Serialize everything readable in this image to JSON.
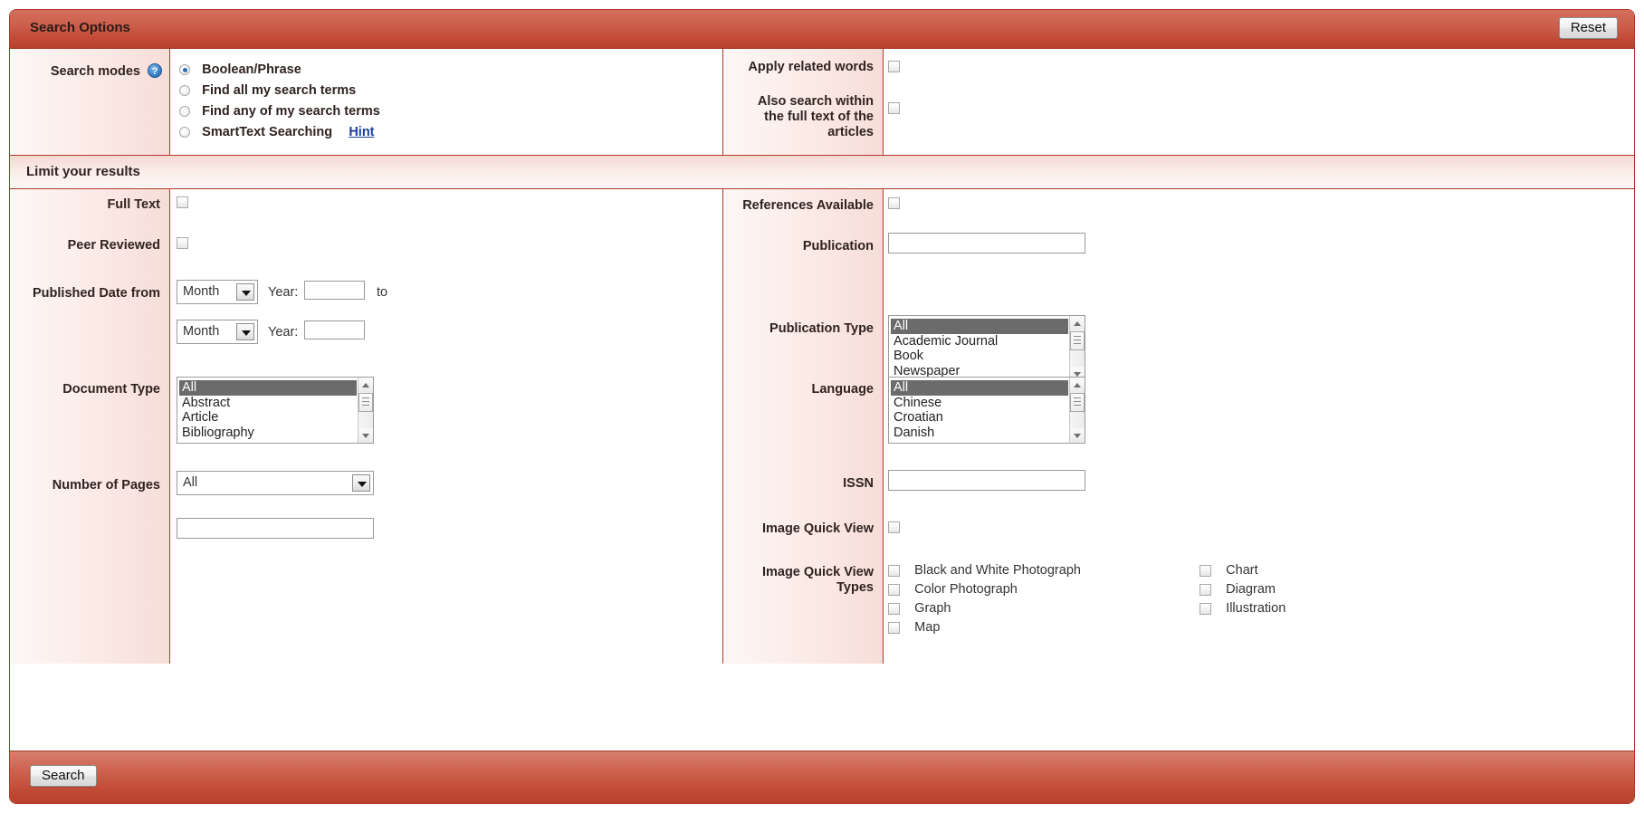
{
  "search_options": {
    "header_title": "Search Options",
    "reset_label": "Reset",
    "search_modes": {
      "label": "Search modes",
      "help_icon_text": "?",
      "options": [
        {
          "label": "Boolean/Phrase",
          "selected": true
        },
        {
          "label": "Find all my search terms",
          "selected": false
        },
        {
          "label": "Find any of my search terms",
          "selected": false
        },
        {
          "label": "SmartText Searching",
          "selected": false
        }
      ],
      "hint_link": "Hint"
    },
    "apply_related_words": {
      "label": "Apply related words",
      "checked": false
    },
    "also_search_full_text": {
      "label": "Also search within the full text of the articles",
      "checked": false
    }
  },
  "limit_results": {
    "header_title": "Limit your results",
    "full_text": {
      "label": "Full Text",
      "checked": false
    },
    "peer_reviewed": {
      "label": "Peer Reviewed",
      "checked": false
    },
    "published_date": {
      "label": "Published Date from",
      "from_month": "Month",
      "from_year_label": "Year:",
      "from_year_value": "",
      "to_label": "to",
      "to_month": "Month",
      "to_year_label": "Year:",
      "to_year_value": ""
    },
    "document_type": {
      "label": "Document Type",
      "options": [
        "All",
        "Abstract",
        "Article",
        "Bibliography"
      ],
      "selected": "All"
    },
    "number_of_pages": {
      "label": "Number of Pages",
      "selected": "All",
      "extra_value": "",
      "extra_placeholder": ""
    },
    "references_available": {
      "label": "References Available",
      "checked": false
    },
    "publication": {
      "label": "Publication",
      "value": "",
      "placeholder": ""
    },
    "publication_type": {
      "label": "Publication Type",
      "options": [
        "All",
        "Academic Journal",
        "Book",
        "Newspaper"
      ],
      "selected": "All"
    },
    "language": {
      "label": "Language",
      "options": [
        "All",
        "Chinese",
        "Croatian",
        "Danish"
      ],
      "selected": "All"
    },
    "issn": {
      "label": "ISSN",
      "value": "",
      "placeholder": ""
    },
    "image_quick_view": {
      "label": "Image Quick View",
      "checked": false
    },
    "image_quick_view_types": {
      "label": "Image Quick View Types",
      "column_1": [
        {
          "label": "Black and White Photograph",
          "checked": false
        },
        {
          "label": "Color Photograph",
          "checked": false
        },
        {
          "label": "Graph",
          "checked": false
        },
        {
          "label": "Map",
          "checked": false
        }
      ],
      "column_2": [
        {
          "label": "Chart",
          "checked": false
        },
        {
          "label": "Diagram",
          "checked": false
        },
        {
          "label": "Illustration",
          "checked": false
        }
      ]
    }
  },
  "footer": {
    "search_label": "Search"
  },
  "colors": {
    "accent_red": "#b8402c",
    "pink_panel": "#f7ddd8",
    "link_blue": "#1a3fa0",
    "selected_gray": "#6b6b6b"
  }
}
